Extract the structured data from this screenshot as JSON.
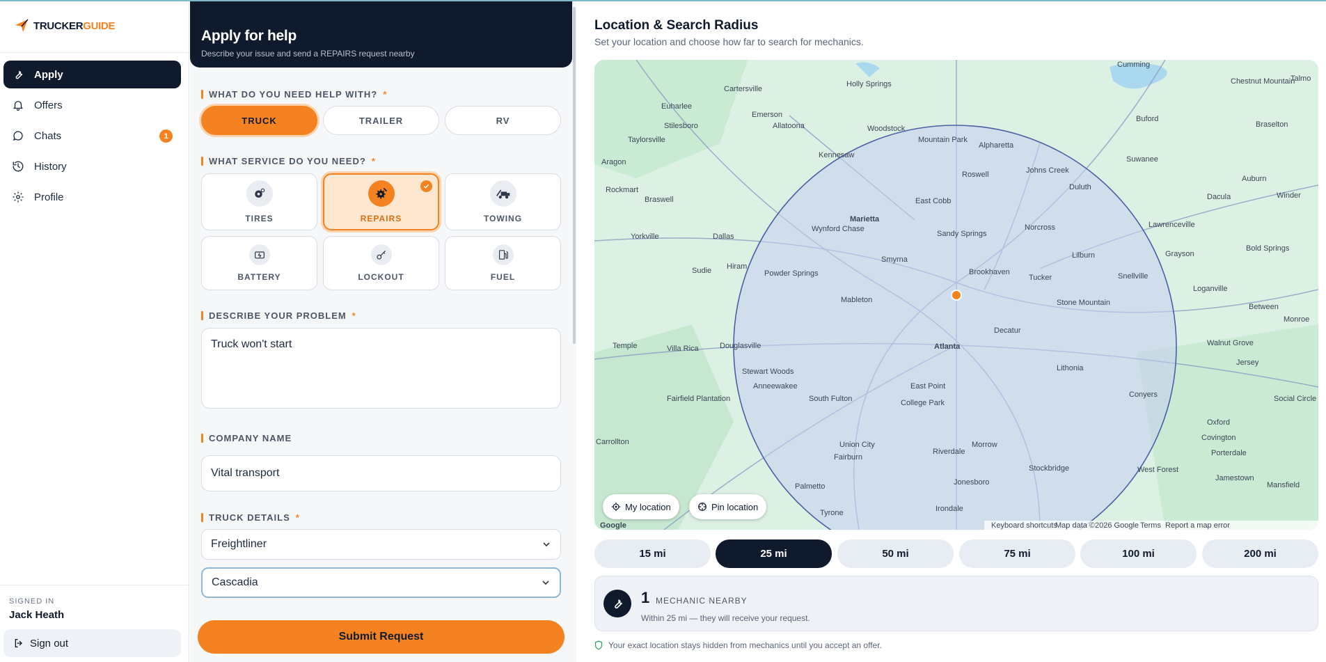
{
  "brand": {
    "name_part1": "TRUCKER",
    "name_part2": "GUIDE"
  },
  "sidebar": {
    "items": [
      {
        "label": "Apply",
        "icon": "wrench-icon",
        "active": true
      },
      {
        "label": "Offers",
        "icon": "bell-icon"
      },
      {
        "label": "Chats",
        "icon": "chat-icon",
        "badge": "1"
      },
      {
        "label": "History",
        "icon": "history-icon"
      },
      {
        "label": "Profile",
        "icon": "gear-icon"
      }
    ],
    "signed_in_label": "SIGNED IN",
    "user_name": "Jack Heath",
    "sign_out_label": "Sign out"
  },
  "form": {
    "title": "Apply for help",
    "subtitle": "Describe your issue and send a REPAIRS request nearby",
    "help_with": {
      "label": "WHAT DO YOU NEED HELP WITH?",
      "required_mark": "*",
      "options": [
        "TRUCK",
        "TRAILER",
        "RV"
      ],
      "selected": "TRUCK"
    },
    "service": {
      "label": "WHAT SERVICE DO YOU NEED?",
      "required_mark": "*",
      "options": [
        "TIRES",
        "REPAIRS",
        "TOWING",
        "BATTERY",
        "LOCKOUT",
        "FUEL"
      ],
      "selected": "REPAIRS"
    },
    "problem": {
      "label": "DESCRIBE YOUR PROBLEM",
      "required_mark": "*",
      "value": "Truck won't start"
    },
    "company": {
      "label": "COMPANY NAME",
      "value": "Vital transport"
    },
    "truck": {
      "label": "TRUCK DETAILS",
      "required_mark": "*",
      "make": "Freightliner",
      "model": "Cascadia"
    },
    "submit_label": "Submit Request"
  },
  "location": {
    "title": "Location & Search Radius",
    "subtitle": "Set your location and choose how far to search for mechanics.",
    "my_location_label": "My location",
    "pin_location_label": "Pin location",
    "map_attribution": [
      "Keyboard shortcuts",
      "Map data ©2026 Google",
      "Terms",
      "Report a map error"
    ],
    "map_logo": "Google",
    "map_labels": [
      "Atlanta",
      "Marietta",
      "Cumming",
      "Cartersville",
      "Holly Springs",
      "Woodstock",
      "Alpharetta",
      "Roswell",
      "Mountain Park",
      "Johns Creek",
      "Duluth",
      "Suwanee",
      "Buford",
      "Kennesaw",
      "East Cobb",
      "Sandy Springs",
      "Norcross",
      "Lawrenceville",
      "Smyrna",
      "Brookhaven",
      "Tucker",
      "Lilburn",
      "Snellville",
      "Stone Mountain",
      "Decatur",
      "Mableton",
      "Powder Springs",
      "Hiram",
      "Dallas",
      "Douglasville",
      "Stewart Woods",
      "Anneewakee",
      "South Fulton",
      "East Point",
      "College Park",
      "Lithonia",
      "Conyers",
      "Union City",
      "Fairburn",
      "Riverdale",
      "Morrow",
      "Stockbridge",
      "Jonesboro",
      "Palmetto",
      "Tyrone",
      "Irondale",
      "Fairfield Plantation",
      "Villa Rica",
      "Temple",
      "Yorkville",
      "Rockmart",
      "Braswell",
      "Aragon",
      "Taylorsville",
      "Stilesboro",
      "Euharlee",
      "Emerson",
      "Allatoona",
      "Dacula",
      "Auburn",
      "Winder",
      "Bold Springs",
      "Grayson",
      "Loganville",
      "Between",
      "Monroe",
      "Walnut Grove",
      "Jersey",
      "Social Circle",
      "Oxford",
      "Covington",
      "Porterdale",
      "Jamestown",
      "Mansfield",
      "West Forest",
      "Chestnut Mountain",
      "Braselton",
      "Talmo",
      "Sudie",
      "Wynford Chase",
      "Carrollton"
    ],
    "radius_options": [
      "15 mi",
      "25 mi",
      "50 mi",
      "75 mi",
      "100 mi",
      "200 mi"
    ],
    "radius_selected": "25 mi",
    "nearby_count": "1",
    "nearby_label": "MECHANIC NEARBY",
    "nearby_desc": "Within 25 mi — they will receive your request.",
    "privacy_note": "Your exact location stays hidden from mechanics until you accept an offer."
  },
  "colors": {
    "accent": "#f58220",
    "navy": "#0f1b2d",
    "radius_fill": "#c7cdf3",
    "radius_stroke": "#4b5fa6"
  }
}
